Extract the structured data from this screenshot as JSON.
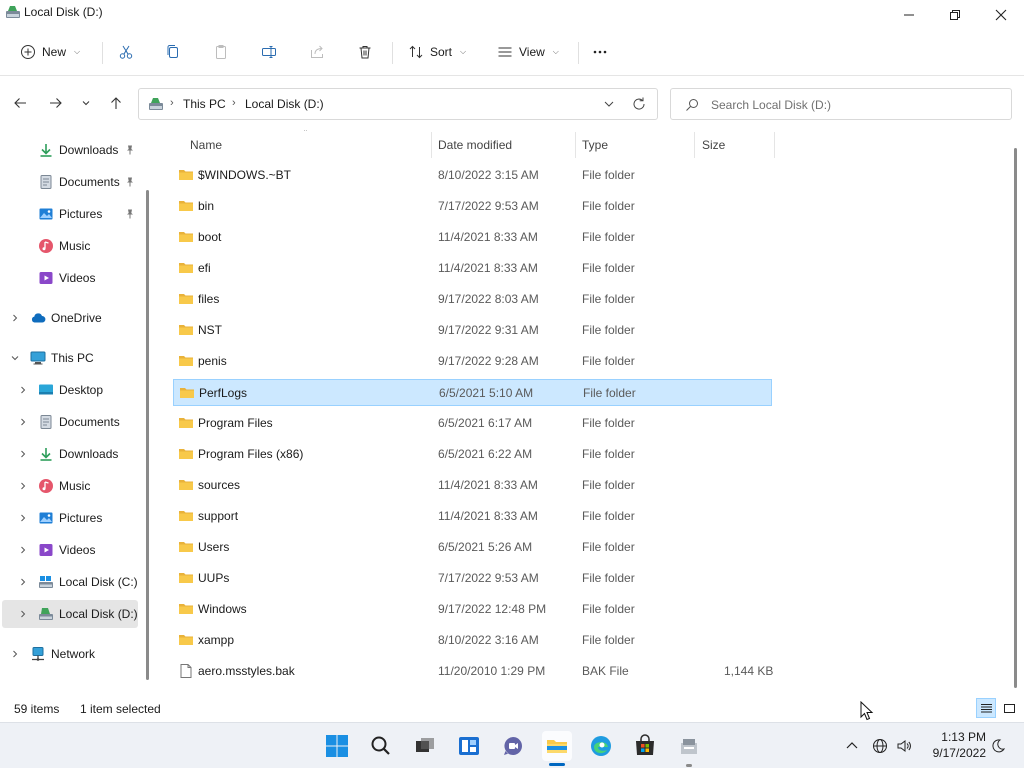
{
  "window": {
    "title": "Local Disk (D:)"
  },
  "commandbar": {
    "new_label": "New",
    "sort_label": "Sort",
    "view_label": "View"
  },
  "address": {
    "crumbs": [
      "This PC",
      "Local Disk (D:)"
    ],
    "search_placeholder": "Search Local Disk (D:)"
  },
  "sidebar": {
    "items": [
      {
        "label": "Downloads",
        "icon": "download-icon",
        "pinned": true
      },
      {
        "label": "Documents",
        "icon": "document-icon",
        "pinned": true
      },
      {
        "label": "Pictures",
        "icon": "picture-icon",
        "pinned": true
      },
      {
        "label": "Music",
        "icon": "music-icon",
        "pinned": false
      },
      {
        "label": "Videos",
        "icon": "video-icon",
        "pinned": false
      },
      {
        "label": "OneDrive",
        "icon": "cloud-icon",
        "pinned": false
      },
      {
        "label": "This PC",
        "icon": "pc-icon",
        "pinned": false
      },
      {
        "label": "Desktop",
        "icon": "desktop-icon",
        "pinned": false
      },
      {
        "label": "Documents",
        "icon": "document-icon",
        "pinned": false
      },
      {
        "label": "Downloads",
        "icon": "download-icon",
        "pinned": false
      },
      {
        "label": "Music",
        "icon": "music-icon",
        "pinned": false
      },
      {
        "label": "Pictures",
        "icon": "picture-icon",
        "pinned": false
      },
      {
        "label": "Videos",
        "icon": "video-icon",
        "pinned": false
      },
      {
        "label": "Local Disk (C:)",
        "icon": "drive-c-icon",
        "pinned": false
      },
      {
        "label": "Local Disk (D:)",
        "icon": "drive-d-icon",
        "pinned": false,
        "selected": true
      },
      {
        "label": "Network",
        "icon": "network-icon",
        "pinned": false
      }
    ]
  },
  "columns": {
    "name": "Name",
    "date": "Date modified",
    "type": "Type",
    "size": "Size"
  },
  "files": [
    {
      "name": "$WINDOWS.~BT",
      "date": "8/10/2022 3:15 AM",
      "type": "File folder",
      "size": ""
    },
    {
      "name": "bin",
      "date": "7/17/2022 9:53 AM",
      "type": "File folder",
      "size": ""
    },
    {
      "name": "boot",
      "date": "11/4/2021 8:33 AM",
      "type": "File folder",
      "size": ""
    },
    {
      "name": "efi",
      "date": "11/4/2021 8:33 AM",
      "type": "File folder",
      "size": ""
    },
    {
      "name": "files",
      "date": "9/17/2022 8:03 AM",
      "type": "File folder",
      "size": ""
    },
    {
      "name": "NST",
      "date": "9/17/2022 9:31 AM",
      "type": "File folder",
      "size": ""
    },
    {
      "name": "penis",
      "date": "9/17/2022 9:28 AM",
      "type": "File folder",
      "size": ""
    },
    {
      "name": "PerfLogs",
      "date": "6/5/2021 5:10 AM",
      "type": "File folder",
      "size": "",
      "selected": true
    },
    {
      "name": "Program Files",
      "date": "6/5/2021 6:17 AM",
      "type": "File folder",
      "size": ""
    },
    {
      "name": "Program Files (x86)",
      "date": "6/5/2021 6:22 AM",
      "type": "File folder",
      "size": ""
    },
    {
      "name": "sources",
      "date": "11/4/2021 8:33 AM",
      "type": "File folder",
      "size": ""
    },
    {
      "name": "support",
      "date": "11/4/2021 8:33 AM",
      "type": "File folder",
      "size": ""
    },
    {
      "name": "Users",
      "date": "6/5/2021 5:26 AM",
      "type": "File folder",
      "size": ""
    },
    {
      "name": "UUPs",
      "date": "7/17/2022 9:53 AM",
      "type": "File folder",
      "size": ""
    },
    {
      "name": "Windows",
      "date": "9/17/2022 12:48 PM",
      "type": "File folder",
      "size": ""
    },
    {
      "name": "xampp",
      "date": "8/10/2022 3:16 AM",
      "type": "File folder",
      "size": ""
    },
    {
      "name": "aero.msstyles.bak",
      "date": "11/20/2010 1:29 PM",
      "type": "BAK File",
      "size": "1,144 KB",
      "isFile": true
    }
  ],
  "status": {
    "items": "59 items",
    "selected": "1 item selected"
  },
  "clock": {
    "time": "1:13 PM",
    "date": "9/17/2022"
  },
  "colors": {
    "accent": "#0067c0",
    "selection": "#cce8ff",
    "folder": "#f8c94a"
  }
}
